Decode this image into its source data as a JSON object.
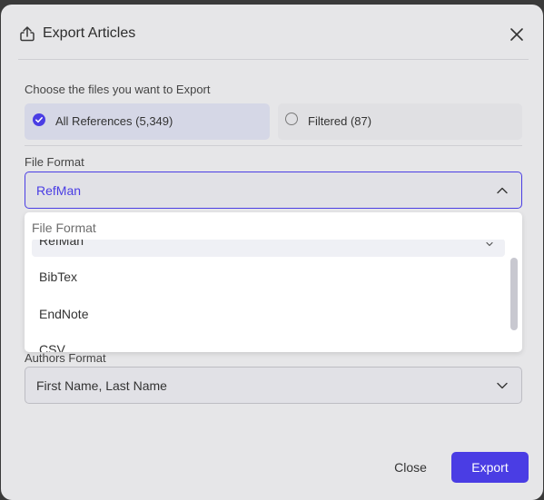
{
  "modal": {
    "title": "Export Articles",
    "title_icon": "export-upload-icon",
    "close_icon": "close-icon"
  },
  "files": {
    "label": "Choose the files you want to Export",
    "options": [
      {
        "label": "All References (5,349)",
        "selected": true
      },
      {
        "label": "Filtered (87)",
        "selected": false
      }
    ],
    "accent_color": "#4a3de4"
  },
  "file_format": {
    "label": "File Format",
    "value": "RefMan",
    "expanded": true,
    "dropdown": {
      "header": "File Format",
      "items": [
        "RefMan",
        "BibTex",
        "EndNote",
        "CSV"
      ]
    }
  },
  "authors_format": {
    "label": "Authors Format",
    "value": "First Name, Last Name"
  },
  "footer": {
    "close_label": "Close",
    "export_label": "Export"
  }
}
